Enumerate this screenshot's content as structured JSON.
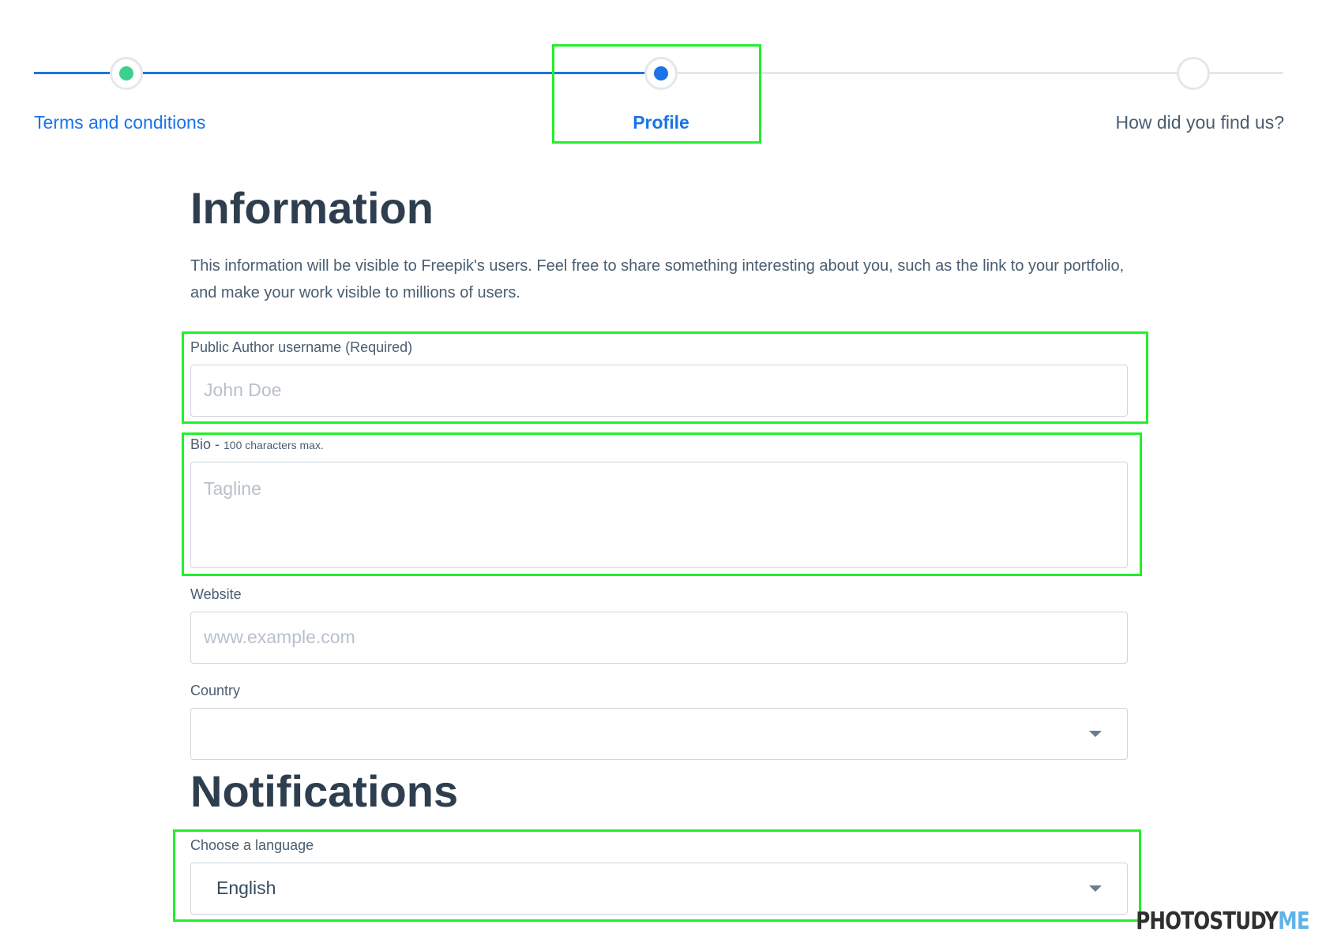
{
  "stepper": {
    "steps": [
      {
        "label": "Terms and conditions",
        "state": "completed"
      },
      {
        "label": "Profile",
        "state": "current"
      },
      {
        "label": "How did you find us?",
        "state": "upcoming"
      }
    ],
    "colors": {
      "active": "#1a73e8",
      "completed_dot": "#3ecf8e",
      "inactive": "#e4e7eb"
    }
  },
  "information": {
    "title": "Information",
    "description": "This information will be visible to Freepik's users. Feel free to share something interesting about you, such as the link to your portfolio, and make your work visible to millions of users."
  },
  "form": {
    "username": {
      "label": "Public Author username (Required)",
      "placeholder": "John Doe",
      "value": ""
    },
    "bio": {
      "label": "Bio - ",
      "hint": "100 characters max.",
      "placeholder": "Tagline",
      "value": ""
    },
    "website": {
      "label": "Website",
      "placeholder": "www.example.com",
      "value": ""
    },
    "country": {
      "label": "Country",
      "value": ""
    }
  },
  "notifications": {
    "title": "Notifications",
    "language": {
      "label": "Choose a language",
      "value": "English"
    }
  },
  "watermark": {
    "part1": "PHOTOSTUDY",
    "part2": "ME"
  },
  "highlight_color": "#22f02a"
}
